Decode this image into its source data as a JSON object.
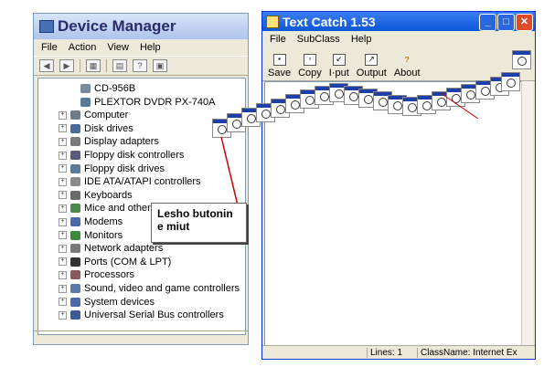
{
  "device_manager": {
    "title": "Device Manager",
    "menu": [
      "File",
      "Action",
      "View",
      "Help"
    ],
    "toolbar_icons": [
      "back-icon",
      "forward-icon",
      "properties-icon",
      "print-icon",
      "help-icon",
      "scan-icon"
    ],
    "tree": [
      {
        "label": "CD-956B",
        "indent": 2,
        "expander": ""
      },
      {
        "label": "PLEXTOR DVDR   PX-740A",
        "indent": 2,
        "expander": ""
      },
      {
        "label": "Computer",
        "indent": 1,
        "expander": "+"
      },
      {
        "label": "Disk drives",
        "indent": 1,
        "expander": "+"
      },
      {
        "label": "Display adapters",
        "indent": 1,
        "expander": "+"
      },
      {
        "label": "Floppy disk controllers",
        "indent": 1,
        "expander": "+"
      },
      {
        "label": "Floppy disk drives",
        "indent": 1,
        "expander": "+"
      },
      {
        "label": "IDE ATA/ATAPI controllers",
        "indent": 1,
        "expander": "+"
      },
      {
        "label": "Keyboards",
        "indent": 1,
        "expander": "+"
      },
      {
        "label": "Mice and other p",
        "indent": 1,
        "expander": "+"
      },
      {
        "label": "Modems",
        "indent": 1,
        "expander": "+"
      },
      {
        "label": "Monitors",
        "indent": 1,
        "expander": "+"
      },
      {
        "label": "Network adapters",
        "indent": 1,
        "expander": "+"
      },
      {
        "label": "Ports (COM & LPT)",
        "indent": 1,
        "expander": "+"
      },
      {
        "label": "Processors",
        "indent": 1,
        "expander": "+"
      },
      {
        "label": "Sound, video and game controllers",
        "indent": 1,
        "expander": "+"
      },
      {
        "label": "System devices",
        "indent": 1,
        "expander": "+"
      },
      {
        "label": "Universal Serial Bus controllers",
        "indent": 1,
        "expander": "+"
      }
    ]
  },
  "text_catch": {
    "title": "Text Catch 1.53",
    "menu": [
      "File",
      "SubClass",
      "Help"
    ],
    "toolbar": [
      {
        "label": "Save",
        "icon": "save-icon"
      },
      {
        "label": "Copy",
        "icon": "copy-icon"
      },
      {
        "label": "I·put",
        "icon": "input-icon"
      },
      {
        "label": "Output",
        "icon": "output-icon"
      },
      {
        "label": "About",
        "icon": "about-icon"
      }
    ],
    "status": {
      "lines": "Lines: 1",
      "classname": "ClassName: Internet Ex"
    }
  },
  "callout": {
    "text": "Lesho butonin e miut"
  }
}
